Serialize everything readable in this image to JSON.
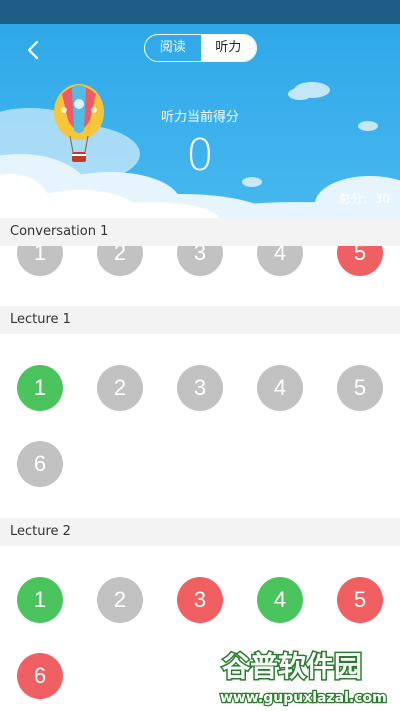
{
  "header": {
    "tabs": [
      {
        "label": "阅读",
        "active": false
      },
      {
        "label": "听力",
        "active": true
      }
    ],
    "score_label": "听力当前得分",
    "score_value": "0",
    "total_label": "总分:",
    "total_value": "30"
  },
  "sections": [
    {
      "title": "Conversation 1",
      "questions": [
        {
          "num": "1",
          "status": "grey"
        },
        {
          "num": "2",
          "status": "grey"
        },
        {
          "num": "3",
          "status": "grey"
        },
        {
          "num": "4",
          "status": "grey"
        },
        {
          "num": "5",
          "status": "red"
        }
      ]
    },
    {
      "title": "Lecture 1",
      "questions": [
        {
          "num": "1",
          "status": "green"
        },
        {
          "num": "2",
          "status": "grey"
        },
        {
          "num": "3",
          "status": "grey"
        },
        {
          "num": "4",
          "status": "grey"
        },
        {
          "num": "5",
          "status": "grey"
        },
        {
          "num": "6",
          "status": "grey"
        }
      ]
    },
    {
      "title": "Lecture 2",
      "questions": [
        {
          "num": "1",
          "status": "green"
        },
        {
          "num": "2",
          "status": "grey"
        },
        {
          "num": "3",
          "status": "red"
        },
        {
          "num": "4",
          "status": "green"
        },
        {
          "num": "5",
          "status": "red"
        },
        {
          "num": "6",
          "status": "red"
        }
      ]
    }
  ],
  "watermark": {
    "name": "谷普软件园",
    "url": "www.gupuxlazal.com"
  },
  "colors": {
    "sky": "#2fa8e9",
    "correct": "#4cc45e",
    "wrong": "#f06062",
    "unanswered": "#c2c2c2"
  }
}
